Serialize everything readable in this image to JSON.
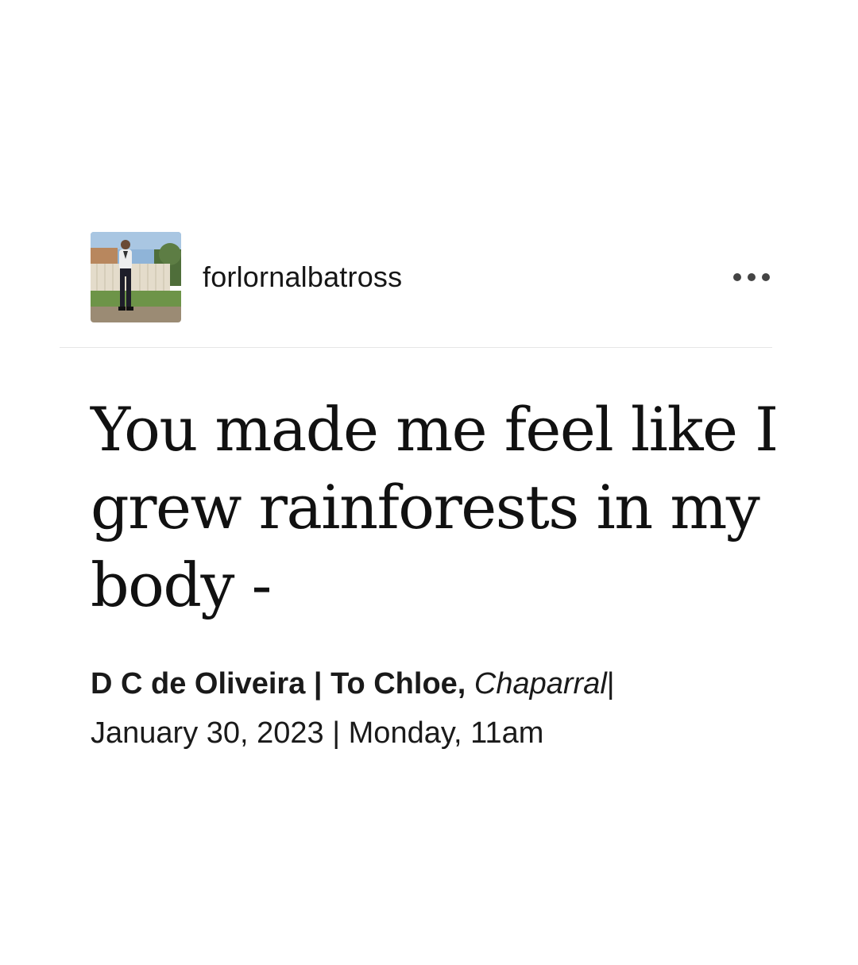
{
  "post": {
    "author": {
      "username": "forlornalbatross",
      "avatar_description": "avatar"
    },
    "more_icon": "more-horizontal-icon",
    "quote": "You made me feel like I grew rainforests in my body -",
    "attribution": {
      "author_and_recipient": "D C de Oliveira | To Chloe,",
      "work_title": "Chaparral",
      "separator": "|",
      "date_time": "January 30, 2023 | Monday, 11am"
    }
  },
  "colors": {
    "background": "#ffffff",
    "text": "#111111",
    "divider": "#e6e6e6",
    "more_dots": "#444444"
  }
}
